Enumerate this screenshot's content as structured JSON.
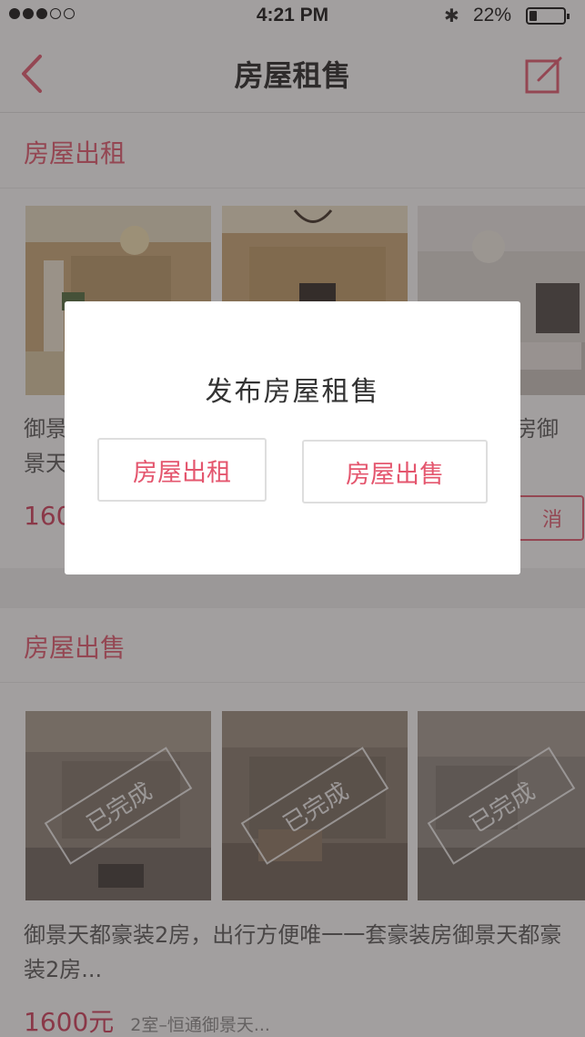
{
  "status_bar": {
    "time": "4:21 PM",
    "battery_percent": "22%",
    "battery_level": 0.22,
    "signal_bars_filled": 3,
    "signal_bars_total": 5
  },
  "nav": {
    "title": "房屋租售",
    "back_icon": "chevron-left-icon",
    "edit_icon": "compose-icon"
  },
  "rent_section": {
    "title": "房屋出租",
    "description_left_line1": "御景",
    "description_left_line2": "景天",
    "description_right_line1": "房御",
    "price_partial": "160",
    "cancel_label": "消"
  },
  "sale_section": {
    "title": "房屋出售",
    "stamps": [
      "已完成",
      "已完成",
      "已完成"
    ],
    "description": "御景天都豪装2房，出行方便唯一一套豪装房御景天都豪装2房...",
    "price": "1600元",
    "price_sub": "2室–恒通御景天..."
  },
  "dialog": {
    "title": "发布房屋租售",
    "buttons": [
      {
        "label": "房屋出租"
      },
      {
        "label": "房屋出售"
      }
    ]
  },
  "colors": {
    "accent": "#e4566e",
    "price": "#d23b58",
    "overlay": "rgba(60,55,55,0.48)"
  }
}
